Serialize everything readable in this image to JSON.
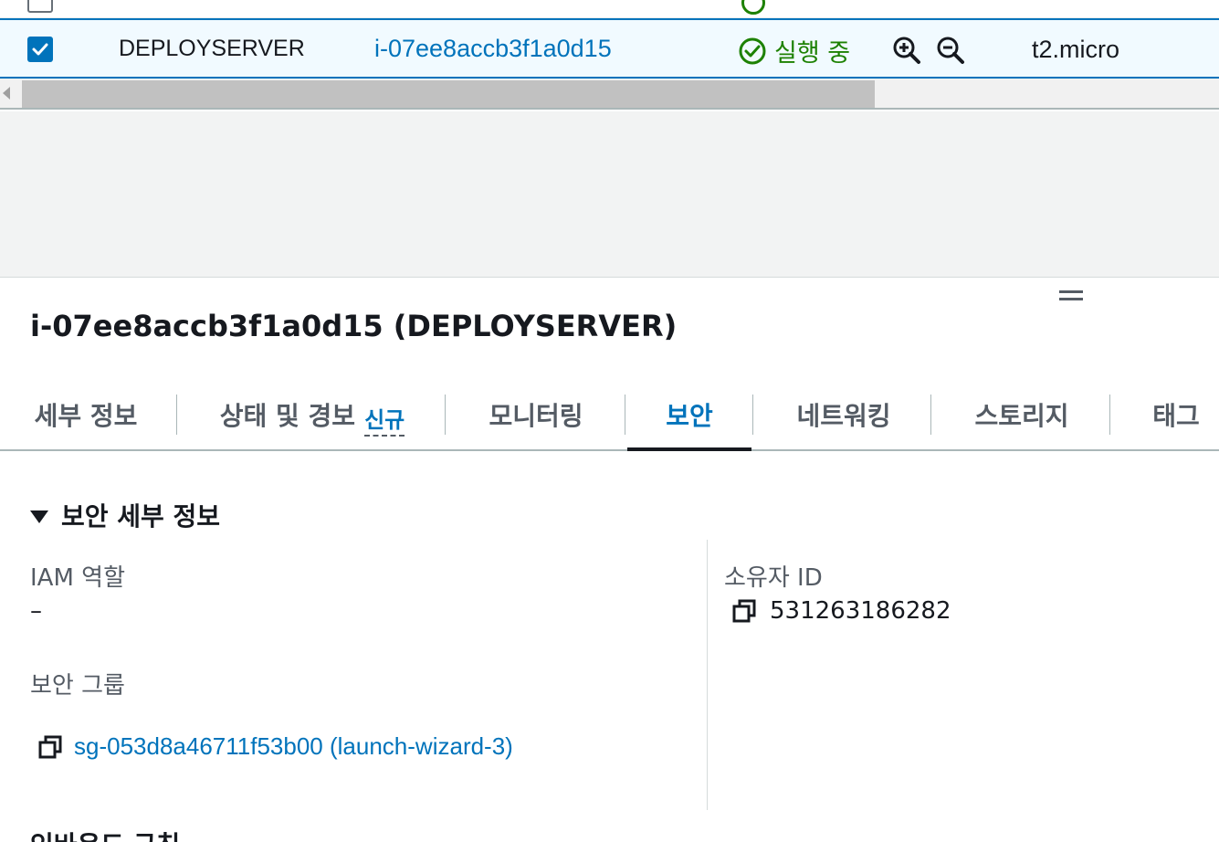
{
  "table": {
    "selected_row": {
      "name": "DEPLOYSERVER",
      "instance_id": "i-07ee8accb3f1a0d15",
      "state": "실행 중",
      "instance_type": "t2.micro"
    }
  },
  "details": {
    "title": "i-07ee8accb3f1a0d15 (DEPLOYSERVER)",
    "tabs": [
      {
        "label": "세부 정보"
      },
      {
        "label": "상태 및 경보",
        "badge": "신규"
      },
      {
        "label": "모니터링"
      },
      {
        "label": "보안",
        "active": true
      },
      {
        "label": "네트워킹"
      },
      {
        "label": "스토리지"
      },
      {
        "label": "태그"
      }
    ],
    "security": {
      "section_title": "보안 세부 정보",
      "iam_role_label": "IAM 역할",
      "iam_role_value": "–",
      "security_groups_label": "보안 그룹",
      "security_group": "sg-053d8a46711f53b00 (launch-wizard-3)",
      "owner_id_label": "소유자 ID",
      "owner_id_value": "531263186282"
    },
    "next_section_title": "인바운드 규칙"
  },
  "colors": {
    "link": "#0073bb",
    "success": "#1d8102",
    "text": "#16191f",
    "secondary_text": "#545b64"
  },
  "icons": [
    "check-icon",
    "status-success-icon",
    "zoom-in-icon",
    "zoom-out-icon",
    "drag-handle-icon",
    "caret-down-icon",
    "copy-icon"
  ]
}
